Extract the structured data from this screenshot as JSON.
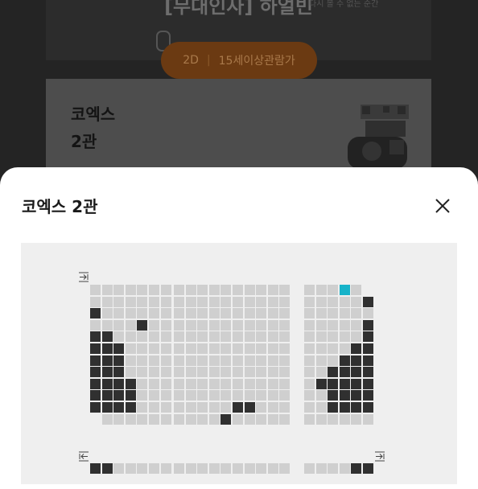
{
  "hero": {
    "movie_title": "[무대인사] 하얼빈",
    "corner_text": "다시 볼 수 없는 순간",
    "format": "2D",
    "age_rating": "15세이상관람가"
  },
  "info_card": {
    "theater": "코엑스",
    "screen": "2관"
  },
  "sheet": {
    "title": "코엑스 2관",
    "close_icon": "close-icon"
  },
  "seat_map": {
    "colors": {
      "free": "#cfcfcf",
      "taken": "#303030",
      "selected": "#17b3c9",
      "background": "#efefef"
    },
    "blocks": [
      {
        "name": "left",
        "rows": [
          "0000000",
          "0000000",
          "1000000",
          "0000100",
          "1100000",
          "1110000",
          "1110000",
          "1110000",
          "1111000",
          "1111000",
          "1111000",
          "-000000"
        ]
      },
      {
        "name": "center",
        "rows": [
          "0000000000",
          "0000000000",
          "0000000000",
          "0000000000",
          "0000000000",
          "0000000000",
          "0000000000",
          "0000000000",
          "0000000000",
          "0000000000",
          "0000011000",
          "0000100000"
        ]
      },
      {
        "name": "right",
        "rows": [
          "00020-",
          "000001",
          "000000",
          "000001",
          "000001",
          "000011",
          "000111",
          "001111",
          "011111",
          "001111",
          "001111",
          "000000"
        ]
      }
    ],
    "lower_blocks": [
      {
        "name": "left-lower",
        "row": "1100000"
      },
      {
        "name": "center-lower",
        "row": "0000000000"
      },
      {
        "name": "right-lower",
        "row": "000011"
      }
    ]
  }
}
